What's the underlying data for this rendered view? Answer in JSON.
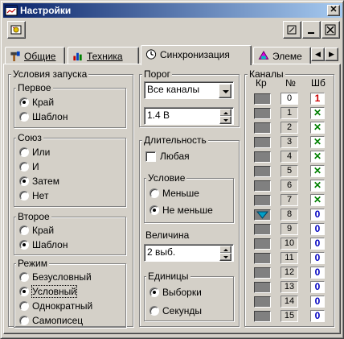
{
  "window": {
    "title": "Настройки",
    "title_icon": "app-window-icon"
  },
  "toolbar": {
    "icon": "settings-small-icon"
  },
  "tabs": [
    {
      "label": "Общие",
      "icon": "hammer-icon"
    },
    {
      "label": "Техника",
      "icon": "chart-icon"
    },
    {
      "label": "Синхронизация",
      "icon": "clock-icon"
    },
    {
      "label": "Элеме",
      "icon": "color-palette-icon"
    }
  ],
  "conditions": {
    "legend": "Условия запуска",
    "first": {
      "legend": "Первое",
      "options": [
        "Край",
        "Шаблон"
      ],
      "selected": 0
    },
    "union": {
      "legend": "Союз",
      "options": [
        "Или",
        "И",
        "Затем",
        "Нет"
      ],
      "selected": 2
    },
    "second": {
      "legend": "Второе",
      "options": [
        "Край",
        "Шаблон"
      ],
      "selected": 1
    },
    "mode": {
      "legend": "Режим",
      "options": [
        "Безусловный",
        "Условный",
        "Однократный",
        "Самописец"
      ],
      "selected": 1
    }
  },
  "threshold": {
    "legend": "Порог",
    "channel_select": "Все каналы",
    "value": "1.4 В"
  },
  "duration": {
    "legend": "Длительность",
    "any_label": "Любая",
    "any_checked": false,
    "condition": {
      "legend": "Условие",
      "options": [
        "Меньше",
        "Не меньше"
      ],
      "selected": 1
    },
    "magnitude_label": "Величина",
    "magnitude_value": "2 выб.",
    "units": {
      "legend": "Единицы",
      "options": [
        "Выборки",
        "Секунды"
      ],
      "selected": 0
    }
  },
  "channels": {
    "legend": "Каналы",
    "headers": {
      "kr": "Кр",
      "num": "№",
      "shb": "Шб"
    },
    "colors": {
      "red": "#cc0000",
      "green": "#008000",
      "blue": "#0000c0",
      "edge_marker": "#00a0c8"
    },
    "rows": [
      {
        "num": "0",
        "shb": "1",
        "shb_color": "red",
        "selected": true,
        "marker": false
      },
      {
        "num": "1",
        "shb": "✕",
        "shb_color": "green",
        "selected": false,
        "marker": false
      },
      {
        "num": "2",
        "shb": "✕",
        "shb_color": "green",
        "selected": false,
        "marker": false
      },
      {
        "num": "3",
        "shb": "✕",
        "shb_color": "green",
        "selected": false,
        "marker": false
      },
      {
        "num": "4",
        "shb": "✕",
        "shb_color": "green",
        "selected": false,
        "marker": false
      },
      {
        "num": "5",
        "shb": "✕",
        "shb_color": "green",
        "selected": false,
        "marker": false
      },
      {
        "num": "6",
        "shb": "✕",
        "shb_color": "green",
        "selected": false,
        "marker": false
      },
      {
        "num": "7",
        "shb": "✕",
        "shb_color": "green",
        "selected": false,
        "marker": false
      },
      {
        "num": "8",
        "shb": "0",
        "shb_color": "blue",
        "selected": false,
        "marker": true
      },
      {
        "num": "9",
        "shb": "0",
        "shb_color": "blue",
        "selected": false,
        "marker": false
      },
      {
        "num": "10",
        "shb": "0",
        "shb_color": "blue",
        "selected": false,
        "marker": false
      },
      {
        "num": "11",
        "shb": "0",
        "shb_color": "blue",
        "selected": false,
        "marker": false
      },
      {
        "num": "12",
        "shb": "0",
        "shb_color": "blue",
        "selected": false,
        "marker": false
      },
      {
        "num": "13",
        "shb": "0",
        "shb_color": "blue",
        "selected": false,
        "marker": false
      },
      {
        "num": "14",
        "shb": "0",
        "shb_color": "blue",
        "selected": false,
        "marker": false
      },
      {
        "num": "15",
        "shb": "0",
        "shb_color": "blue",
        "selected": false,
        "marker": false
      }
    ]
  }
}
